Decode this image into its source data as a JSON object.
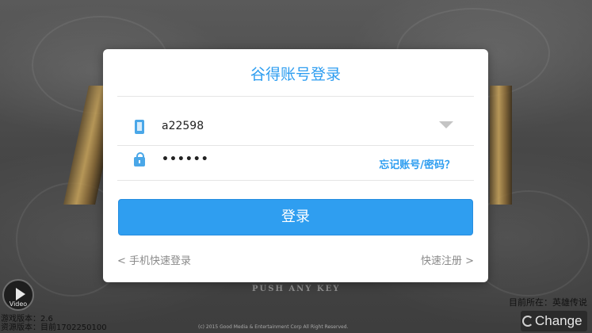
{
  "background": {
    "push_key": "PUSH ANY KEY",
    "copyright": "(c) 2015 Good Media & Entertainment Corp All Right Reserved.",
    "video_label": "Video",
    "game_version": "游戏版本：2.6",
    "resource_version": "资源版本：目前1702250100",
    "region": "目前所在：英雄传说",
    "change_label": "Change"
  },
  "dialog": {
    "title": "谷得账号登录",
    "account_value": "a22598",
    "password_mask": "••••••",
    "forgot_link": "忘记账号/密码？",
    "login_button": "登录",
    "phone_login_link": "< 手机快速登录",
    "quick_register_link": "快速注册 >"
  },
  "colors": {
    "accent": "#2d9df0",
    "link_gray": "#8a8a8a"
  },
  "icons": [
    "phone-icon",
    "lock-icon",
    "dropdown-arrow-icon",
    "play-icon",
    "swap-icon"
  ]
}
